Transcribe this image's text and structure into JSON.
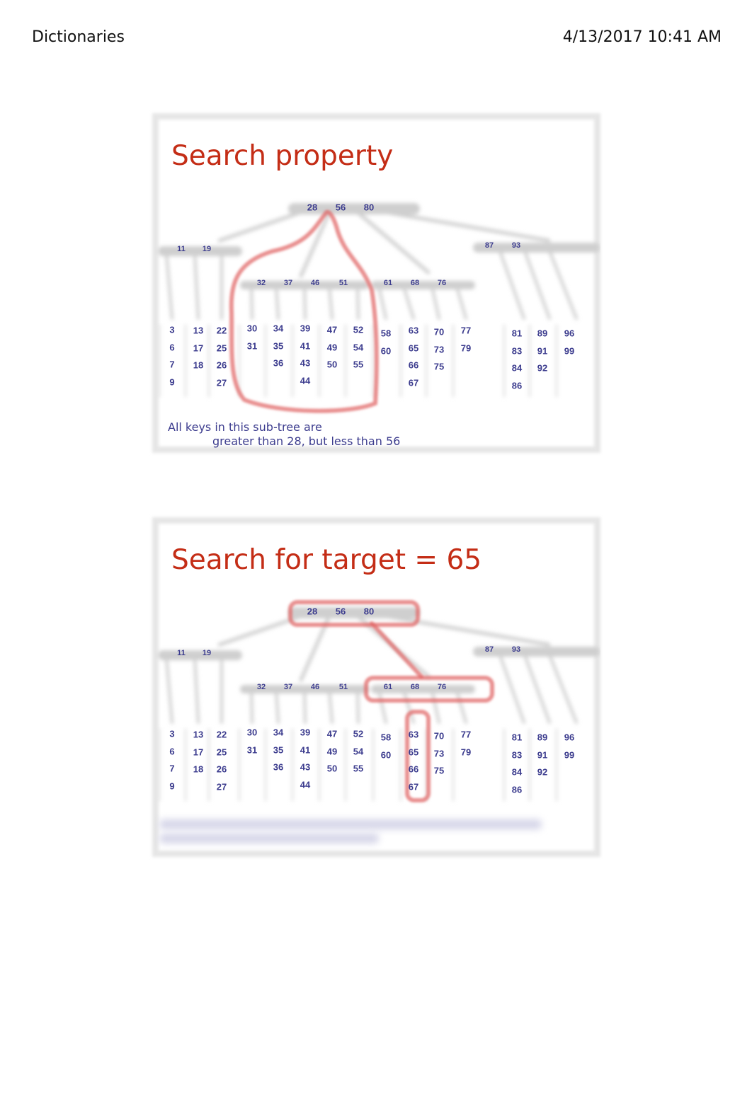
{
  "header": {
    "title": "Dictionaries",
    "datetime": "4/13/2017 10:41 AM"
  },
  "slides": [
    {
      "title": "Search property",
      "tree": {
        "root": [
          28,
          56,
          80
        ],
        "internal": [
          [
            11,
            19
          ],
          [
            32,
            37,
            46,
            51
          ],
          [
            61,
            68,
            76
          ],
          [
            87,
            93
          ]
        ],
        "leaves": [
          [
            3,
            6,
            7,
            9
          ],
          [
            13,
            17,
            18
          ],
          [
            22,
            25,
            26,
            27
          ],
          [
            30,
            31
          ],
          [
            34,
            35,
            36
          ],
          [
            39,
            41,
            43,
            44
          ],
          [
            47,
            49,
            50
          ],
          [
            52,
            54,
            55
          ],
          [
            58,
            60
          ],
          [
            63,
            65,
            66,
            67
          ],
          [
            70,
            73,
            75
          ],
          [
            77,
            79
          ],
          [
            81,
            83,
            84,
            86
          ],
          [
            89,
            91,
            92
          ],
          [
            96,
            99
          ]
        ]
      },
      "highlight": "subtree between 28 and 56",
      "caption_line1": "All keys in this sub-tree are",
      "caption_line2": "greater than 28,  but less than 56"
    },
    {
      "title": "Search for target = 65",
      "tree": {
        "root": [
          28,
          56,
          80
        ],
        "internal": [
          [
            11,
            19
          ],
          [
            32,
            37,
            46,
            51
          ],
          [
            61,
            68,
            76
          ],
          [
            87,
            93
          ]
        ],
        "leaves": [
          [
            3,
            6,
            7,
            9
          ],
          [
            13,
            17,
            18
          ],
          [
            22,
            25,
            26,
            27
          ],
          [
            30,
            31
          ],
          [
            34,
            35,
            36
          ],
          [
            39,
            41,
            43,
            44
          ],
          [
            47,
            49,
            50
          ],
          [
            52,
            54,
            55
          ],
          [
            58,
            60
          ],
          [
            63,
            65,
            66,
            67
          ],
          [
            70,
            73,
            75
          ],
          [
            77,
            79
          ],
          [
            81,
            83,
            84,
            86
          ],
          [
            89,
            91,
            92
          ],
          [
            96,
            99
          ]
        ]
      },
      "highlight": "search path root -> [61,68,76] -> leaf [63,65,66,67]"
    }
  ],
  "colors": {
    "title": "#c42d16",
    "keys": "#3c3c8e",
    "highlight": "#e06060",
    "frame": "#e6e6e6"
  }
}
